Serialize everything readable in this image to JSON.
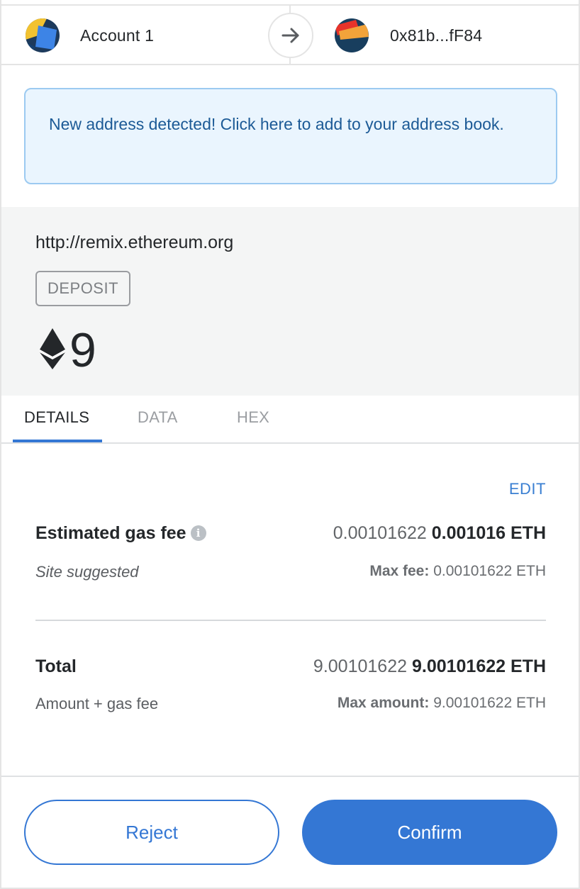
{
  "header": {
    "from_account": "Account 1",
    "to_address": "0x81b...fF84",
    "arrow_icon": "arrow-right-icon"
  },
  "banner": {
    "text": "New address detected! Click here to add to your address book."
  },
  "summary": {
    "origin": "http://remix.ethereum.org",
    "badge": "DEPOSIT",
    "currency_icon": "ethereum-icon",
    "amount": "9"
  },
  "tabs": [
    {
      "label": "DETAILS",
      "active": true
    },
    {
      "label": "DATA",
      "active": false
    },
    {
      "label": "HEX",
      "active": false
    }
  ],
  "details": {
    "edit_label": "EDIT",
    "gas": {
      "label": "Estimated gas fee",
      "info_icon": "info-icon",
      "value_secondary": "0.00101622",
      "value_primary": "0.001016 ETH",
      "sub_label": "Site suggested",
      "max_label": "Max fee:",
      "max_value": "0.00101622 ETH"
    },
    "total": {
      "label": "Total",
      "value_secondary": "9.00101622",
      "value_primary": "9.00101622 ETH",
      "sub_label": "Amount + gas fee",
      "max_label": "Max amount:",
      "max_value": "9.00101622 ETH"
    }
  },
  "footer": {
    "reject_label": "Reject",
    "confirm_label": "Confirm"
  },
  "colors": {
    "accent": "#3477d4",
    "banner_bg": "#eaf5fe",
    "banner_border": "#9ccaf1",
    "banner_text": "#1c5a96",
    "summary_bg": "#f4f5f5"
  }
}
